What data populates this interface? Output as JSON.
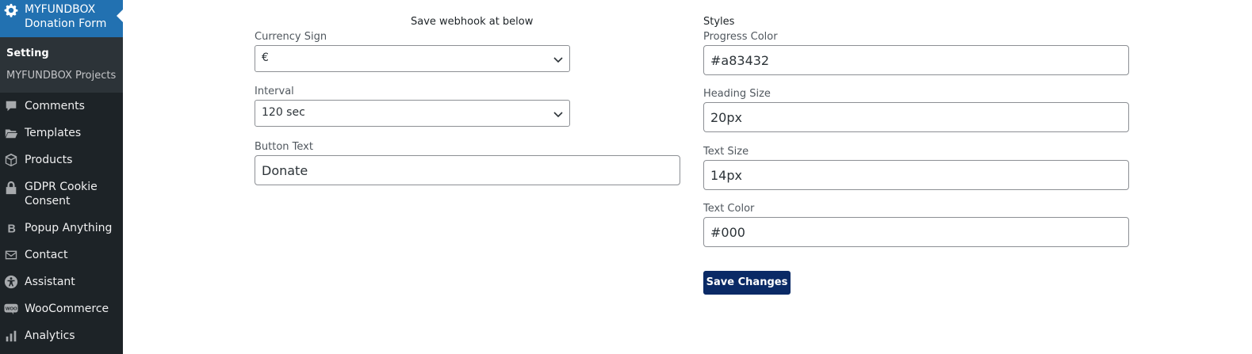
{
  "sidebar": {
    "plugin_title_line1": "MYFUNDBOX",
    "plugin_title_line2": "Donation Form",
    "submenu": {
      "current": "Setting",
      "projects": "MYFUNDBOX Projects"
    },
    "items": [
      {
        "label": "Comments",
        "icon": "comment-icon"
      },
      {
        "label": "Templates",
        "icon": "folder-icon"
      },
      {
        "label": "Products",
        "icon": "cube-icon"
      },
      {
        "label_line1": "GDPR Cookie",
        "label_line2": "Consent",
        "icon": "lock-icon"
      },
      {
        "label": "Popup Anything",
        "icon": "b-icon"
      },
      {
        "label": "Contact",
        "icon": "envelope-icon"
      },
      {
        "label": "Assistant",
        "icon": "accessibility-icon"
      },
      {
        "label": "WooCommerce",
        "icon": "woo-icon"
      },
      {
        "label": "Analytics",
        "icon": "bar-chart-icon"
      }
    ]
  },
  "form": {
    "webhook_note": "Save webhook at below",
    "currency": {
      "label": "Currency Sign",
      "value": "€"
    },
    "interval": {
      "label": "Interval",
      "value": "120 sec"
    },
    "button_text": {
      "label": "Button Text",
      "value": "Donate"
    },
    "styles_heading": "Styles",
    "progress_color": {
      "label": "Progress Color",
      "value": "#a83432"
    },
    "heading_size": {
      "label": "Heading Size",
      "value": "20px"
    },
    "text_size": {
      "label": "Text Size",
      "value": "14px"
    },
    "text_color": {
      "label": "Text Color",
      "value": "#000"
    },
    "save_label": "Save Changes"
  },
  "colors": {
    "sidebar_bg": "#1d2327",
    "submenu_bg": "#2c3338",
    "active_menu": "#2271b1",
    "save_button": "#0a2a66"
  }
}
